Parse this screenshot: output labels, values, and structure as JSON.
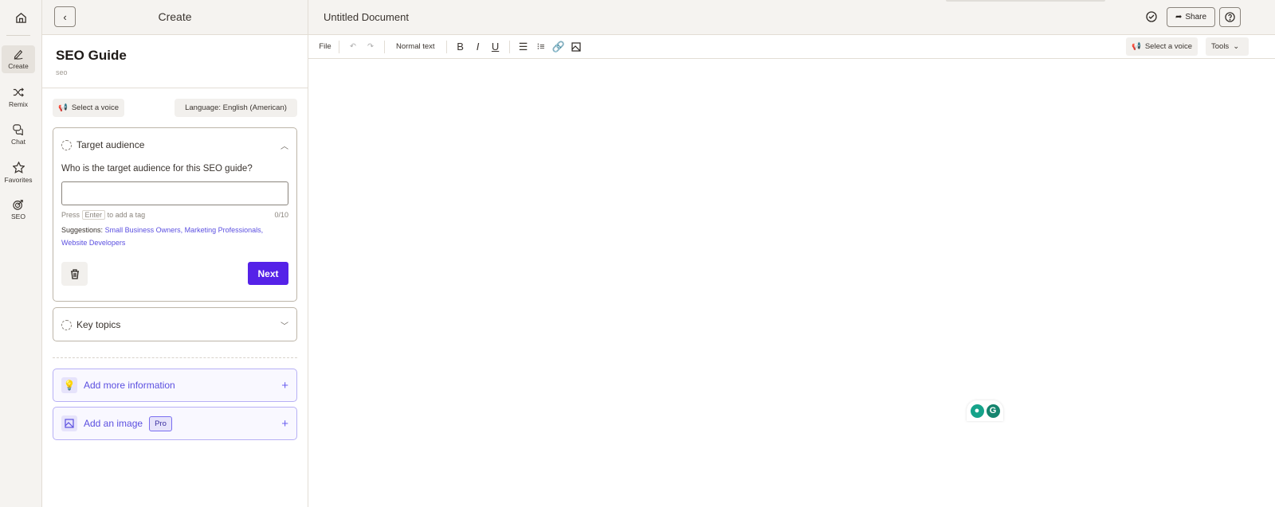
{
  "rail": {
    "items": [
      {
        "label": "Create",
        "icon": "pen-icon"
      },
      {
        "label": "Remix",
        "icon": "shuffle-icon"
      },
      {
        "label": "Chat",
        "icon": "chat-icon"
      },
      {
        "label": "Favorites",
        "icon": "star-icon"
      },
      {
        "label": "SEO",
        "icon": "target-icon"
      }
    ]
  },
  "panel": {
    "header": "Create",
    "title": "SEO Guide",
    "subtitle": "seo",
    "voice_label": "Select a voice",
    "language_label": "Language: English (American)",
    "step1": {
      "title": "Target audience",
      "question": "Who is the target audience for this SEO guide?",
      "input_value": "",
      "hint_pre": "Press",
      "hint_key": "Enter",
      "hint_post": "to add a tag",
      "count": "0/10",
      "suggestions_label": "Suggestions:",
      "suggestions": [
        "Small Business Owners,",
        "Marketing Professionals,",
        "Website Developers"
      ],
      "next": "Next"
    },
    "step2": {
      "title": "Key topics"
    },
    "add_info": "Add more information",
    "add_image": "Add an image",
    "pro": "Pro"
  },
  "editor": {
    "title": "Untitled Document",
    "share": "Share",
    "toolbar": {
      "file": "File",
      "style": "Normal text",
      "voice": "Select a voice",
      "tools": "Tools"
    }
  },
  "colors": {
    "accent": "#5522e8",
    "link": "#5b4fe0",
    "grammarly": "#15846e"
  }
}
